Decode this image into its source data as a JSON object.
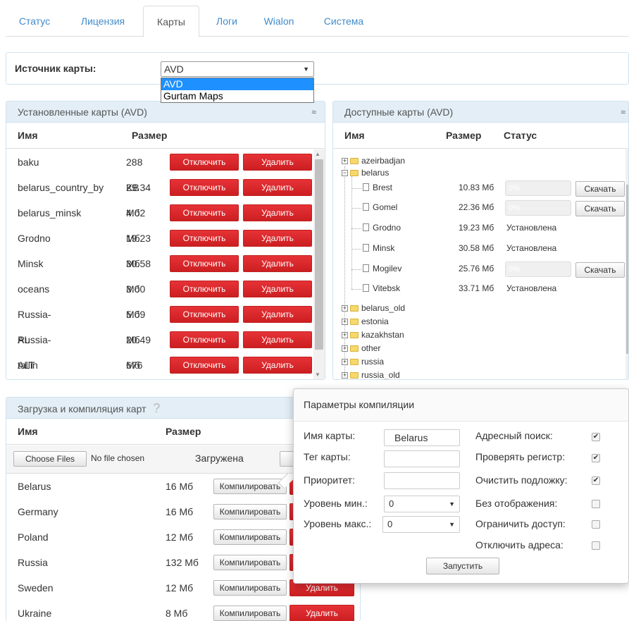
{
  "tabs": [
    {
      "label": "Статус",
      "active": false
    },
    {
      "label": "Лицензия",
      "active": false
    },
    {
      "label": "Карты",
      "active": true
    },
    {
      "label": "Логи",
      "active": false
    },
    {
      "label": "Wialon",
      "active": false
    },
    {
      "label": "Система",
      "active": false
    }
  ],
  "source": {
    "label": "Источник карты:",
    "selected": "AVD",
    "options": [
      "AVD",
      "Gurtam Maps"
    ]
  },
  "installed": {
    "title": "Установленные карты (AVD)",
    "col_name": "Имя",
    "col_size": "Размер",
    "disable_label": "Отключить",
    "delete_label": "Удалить",
    "rows": [
      {
        "name": "baku",
        "size": "288 KB"
      },
      {
        "name": "belarus_country_by",
        "size": "29.34 Мб"
      },
      {
        "name": "belarus_minsk",
        "size": "4.02 Мб"
      },
      {
        "name": "Grodno",
        "size": "19.23 Мб"
      },
      {
        "name": "Minsk",
        "size": "30.58 Мб"
      },
      {
        "name": "oceans",
        "size": "3.00 Мб"
      },
      {
        "name": "Russia-AL",
        "size": "5.09 Мб"
      },
      {
        "name": "Russia-ALT",
        "size": "20.49 Мб"
      },
      {
        "name": "tallin",
        "size": "676 KB"
      }
    ]
  },
  "available": {
    "title": "Доступные карты (AVD)",
    "col_name": "Имя",
    "col_size": "Размер",
    "col_status": "Статус",
    "download_label": "Скачать",
    "tree": {
      "azeirbadjan": "azeirbadjan",
      "belarus": "belarus",
      "children": [
        {
          "name": "Brest",
          "size": "10.83 Мб",
          "status": "",
          "progress": "0%"
        },
        {
          "name": "Gomel",
          "size": "22.36 Мб",
          "status": "",
          "progress": "0%"
        },
        {
          "name": "Grodno",
          "size": "19.23 Мб",
          "status": "Установлена",
          "progress": ""
        },
        {
          "name": "Minsk",
          "size": "30.58 Мб",
          "status": "Установлена",
          "progress": ""
        },
        {
          "name": "Mogilev",
          "size": "25.76 Мб",
          "status": "",
          "progress": "0%"
        },
        {
          "name": "Vitebsk",
          "size": "33.71 Мб",
          "status": "Установлена",
          "progress": ""
        }
      ],
      "folders": [
        "belarus_old",
        "estonia",
        "kazakhstan",
        "other",
        "russia",
        "russia_old"
      ]
    }
  },
  "upload": {
    "title": "Загрузка и компиляция карт",
    "help": "?",
    "col_name": "Имя",
    "col_size": "Размер",
    "choose_files": "Choose Files",
    "no_file": "No file chosen",
    "uploaded": "Загружена",
    "compile_label": "Компилировать",
    "delete_label": "Удалить",
    "rows": [
      {
        "name": "Belarus",
        "size": "16 Мб"
      },
      {
        "name": "Germany",
        "size": "16 Мб"
      },
      {
        "name": "Poland",
        "size": "12 Мб"
      },
      {
        "name": "Russia",
        "size": "132 Мб"
      },
      {
        "name": "Sweden",
        "size": "12 Мб"
      },
      {
        "name": "Ukraine",
        "size": "8 Мб"
      }
    ]
  },
  "compile": {
    "title": "Параметры компиляции",
    "map_name_label": "Имя карты:",
    "map_name_value": "Belarus",
    "tag_label": "Тег карты:",
    "priority_label": "Приоритет:",
    "min_level_label": "Уровень мин.:",
    "min_level_value": "0",
    "max_level_label": "Уровень макс.:",
    "max_level_value": "0",
    "address_search": "Адресный поиск:",
    "check_case": "Проверять регистр:",
    "clear_base": "Очистить подложку:",
    "no_display": "Без отображения:",
    "restrict_access": "Ограничить доступ:",
    "disable_addresses": "Отключить адреса:",
    "run_label": "Запустить",
    "checked": [
      "✔",
      "✔",
      "✔"
    ]
  },
  "colors": {
    "accent": "#428bca",
    "danger": "#d9272b",
    "panel_head": "#e3eef6"
  }
}
